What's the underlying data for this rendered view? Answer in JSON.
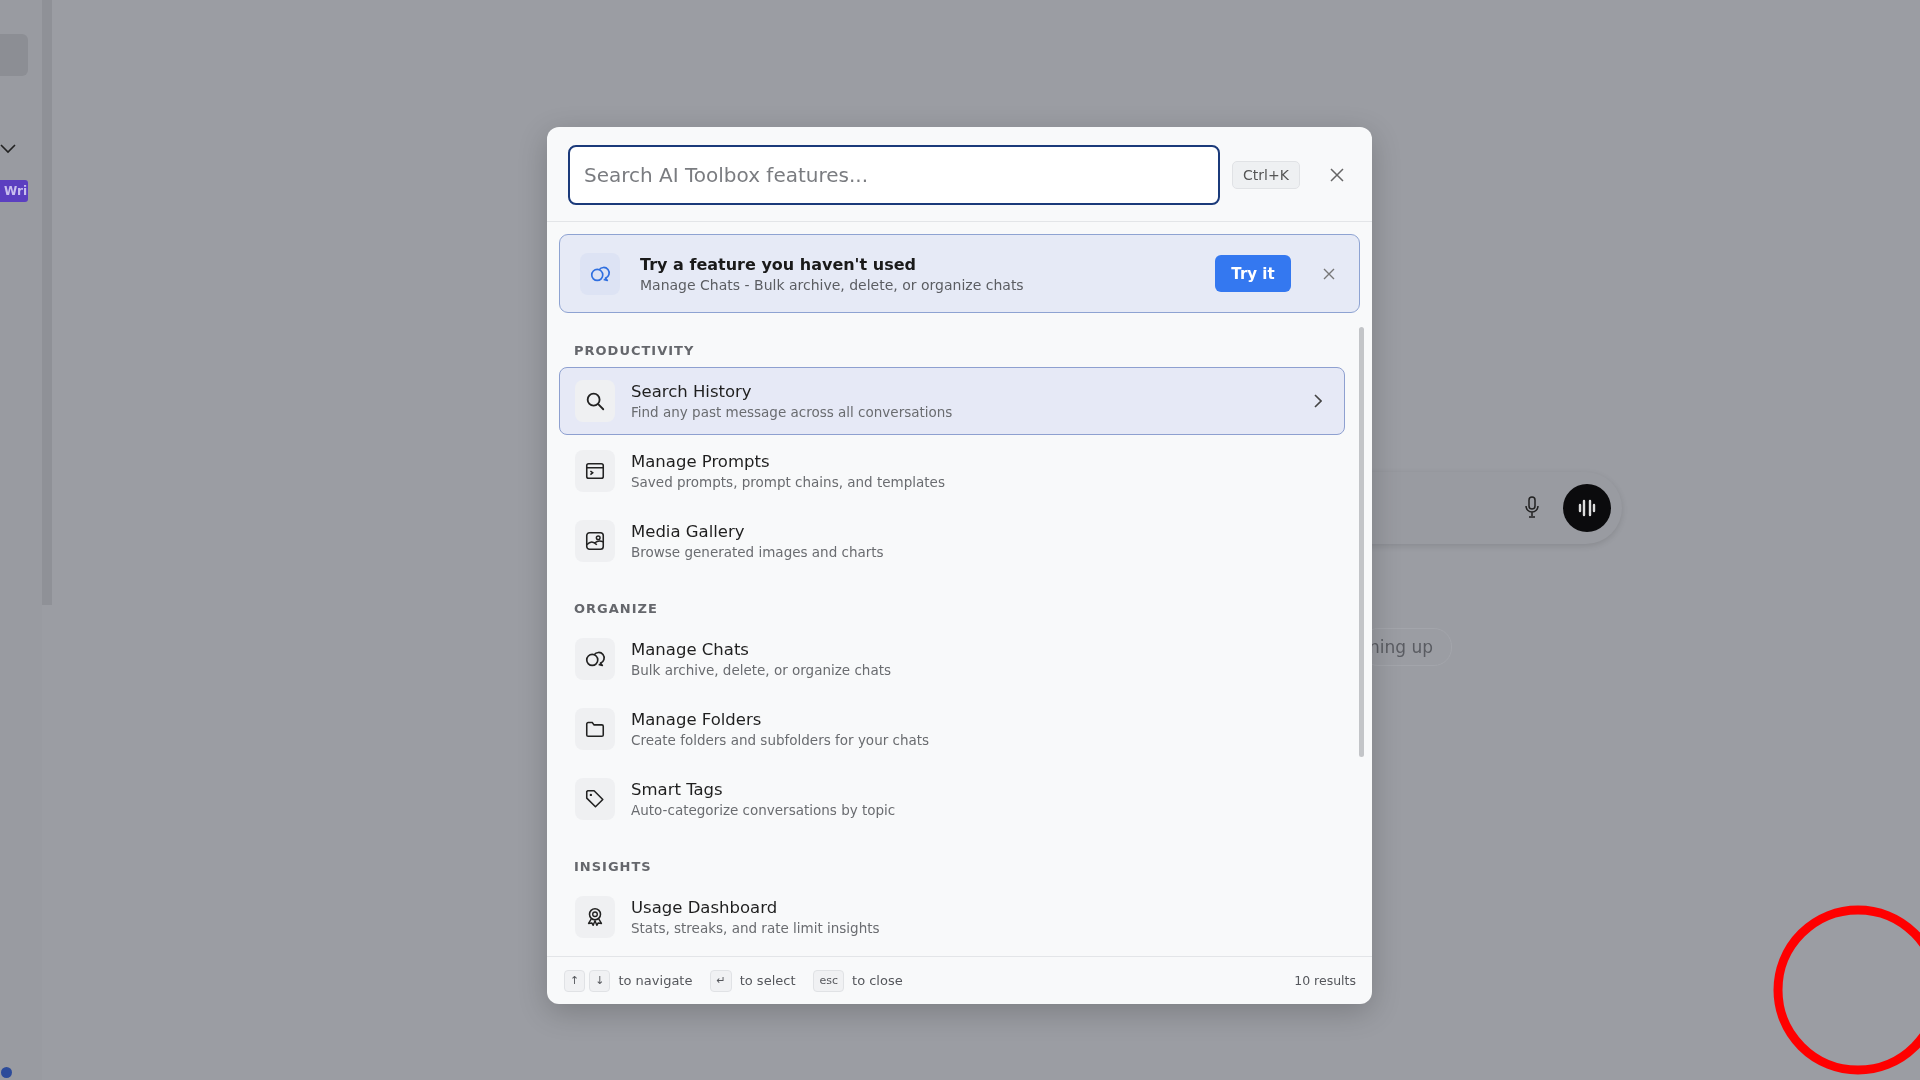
{
  "background": {
    "sidebar": {
      "badge": "Wri"
    },
    "suggestion_chip": "ning up"
  },
  "palette": {
    "search": {
      "placeholder": "Search AI Toolbox features..."
    },
    "shortcut": "Ctrl+K",
    "suggestion": {
      "title": "Try a feature you haven't used",
      "description": "Manage Chats - Bulk archive, delete, or organize chats",
      "button": "Try it"
    },
    "sections": [
      {
        "title": "PRODUCTIVITY",
        "items": [
          {
            "title": "Search History",
            "description": "Find any past message across all conversations",
            "selected": true
          },
          {
            "title": "Manage Prompts",
            "description": "Saved prompts, prompt chains, and templates",
            "selected": false
          },
          {
            "title": "Media Gallery",
            "description": "Browse generated images and charts",
            "selected": false
          }
        ]
      },
      {
        "title": "ORGANIZE",
        "items": [
          {
            "title": "Manage Chats",
            "description": "Bulk archive, delete, or organize chats",
            "selected": false
          },
          {
            "title": "Manage Folders",
            "description": "Create folders and subfolders for your chats",
            "selected": false
          },
          {
            "title": "Smart Tags",
            "description": "Auto-categorize conversations by topic",
            "selected": false
          }
        ]
      },
      {
        "title": "INSIGHTS",
        "items": [
          {
            "title": "Usage Dashboard",
            "description": "Stats, streaks, and rate limit insights",
            "selected": false
          }
        ]
      }
    ],
    "footer": {
      "hints": [
        {
          "keys": [
            "↑",
            "↓"
          ],
          "label": "to navigate"
        },
        {
          "keys": [
            "↵"
          ],
          "label": "to select"
        },
        {
          "keys": [
            "esc"
          ],
          "label": "to close"
        }
      ],
      "count": "10 results"
    }
  }
}
